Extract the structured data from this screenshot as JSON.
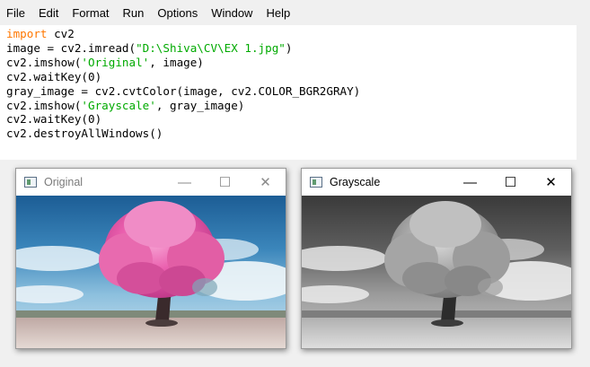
{
  "menu": [
    "File",
    "Edit",
    "Format",
    "Run",
    "Options",
    "Window",
    "Help"
  ],
  "code_lines": [
    {
      "parts": [
        {
          "t": "import",
          "c": "kw"
        },
        {
          "t": " cv2",
          "c": ""
        }
      ]
    },
    {
      "parts": [
        {
          "t": "image = cv2.imread(",
          "c": ""
        },
        {
          "t": "\"D:\\Shiva\\CV\\EX 1.jpg\"",
          "c": "str"
        },
        {
          "t": ")",
          "c": ""
        }
      ]
    },
    {
      "parts": [
        {
          "t": "cv2.imshow(",
          "c": ""
        },
        {
          "t": "'Original'",
          "c": "str"
        },
        {
          "t": ", image)",
          "c": ""
        }
      ]
    },
    {
      "parts": [
        {
          "t": "cv2.waitKey(0)",
          "c": ""
        }
      ]
    },
    {
      "parts": [
        {
          "t": "gray_image = cv2.cvtColor(image, cv2.COLOR_BGR2GRAY)",
          "c": ""
        }
      ]
    },
    {
      "parts": [
        {
          "t": "cv2.imshow(",
          "c": ""
        },
        {
          "t": "'Grayscale'",
          "c": "str"
        },
        {
          "t": ", gray_image)",
          "c": ""
        }
      ]
    },
    {
      "parts": [
        {
          "t": "cv2.waitKey(0)",
          "c": ""
        }
      ]
    },
    {
      "parts": [
        {
          "t": "cv2.destroyAllWindows()",
          "c": ""
        }
      ]
    }
  ],
  "windows": {
    "original": {
      "title": "Original",
      "active": false
    },
    "grayscale": {
      "title": "Grayscale",
      "active": true
    }
  },
  "controls": {
    "minimize": "—",
    "maximize": "☐",
    "close": "✕"
  },
  "icons": {
    "window_app": "opencv-window-icon"
  }
}
